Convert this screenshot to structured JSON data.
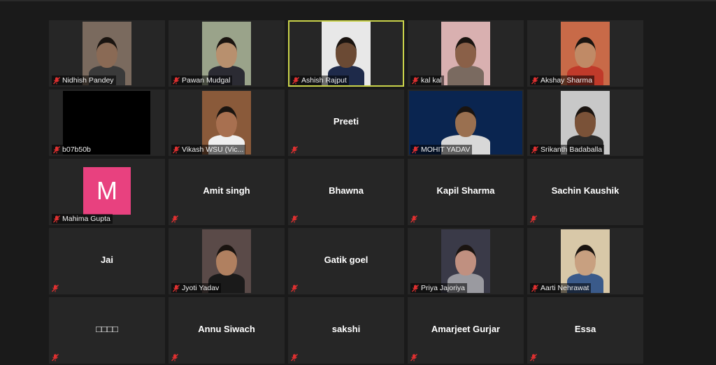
{
  "participants": [
    {
      "name": "Nidhish Pandey",
      "video": true,
      "bg": "#7a6a5e",
      "skin": "#8a6a55",
      "shirt": "#3a3a3a",
      "center": ""
    },
    {
      "name": "Pawan Mudgal",
      "video": true,
      "bg": "#9aa38a",
      "skin": "#b8906e",
      "shirt": "#2b2b33",
      "center": ""
    },
    {
      "name": "Ashish Rajput",
      "video": true,
      "active": true,
      "bg": "#e8e8e8",
      "skin": "#6b4a34",
      "shirt": "#1e2a4a",
      "center": ""
    },
    {
      "name": "kal kal",
      "video": true,
      "bg": "#d9b0b0",
      "skin": "#8a6048",
      "shirt": "#7a6a60",
      "center": ""
    },
    {
      "name": "Akshay Sharma",
      "video": true,
      "bg": "#c86a48",
      "skin": "#c08a66",
      "shirt": "#c03a2a",
      "center": ""
    },
    {
      "name": "b07b50b",
      "video": true,
      "bg": "#000000",
      "skin": "",
      "shirt": "",
      "center": ""
    },
    {
      "name": "Vikash WSU (Vic...",
      "video": true,
      "bg": "#8a5a3a",
      "skin": "#a87050",
      "shirt": "#f0f0f0",
      "center": ""
    },
    {
      "name": "",
      "video": false,
      "center": "Preeti"
    },
    {
      "name": "MOHIT YADAV",
      "video": true,
      "wide": true,
      "bg": "#0a2550",
      "skin": "#9a7050",
      "shirt": "#d8d8d8",
      "center": ""
    },
    {
      "name": "Srikanth Badaballa",
      "video": true,
      "bg": "#c8c8c8",
      "skin": "#7a5238",
      "shirt": "#2a2a2a",
      "center": ""
    },
    {
      "name": "Mahima Gupta",
      "video": false,
      "avatar": "M",
      "center": ""
    },
    {
      "name": "",
      "video": false,
      "center": "Amit singh"
    },
    {
      "name": "",
      "video": false,
      "center": "Bhawna"
    },
    {
      "name": "",
      "video": false,
      "center": "Kapil Sharma"
    },
    {
      "name": "",
      "video": false,
      "center": "Sachin Kaushik"
    },
    {
      "name": "",
      "video": false,
      "center": "Jai"
    },
    {
      "name": "Jyoti Yadav",
      "video": true,
      "bg": "#5a4a48",
      "skin": "#b08060",
      "shirt": "#1a1a1a",
      "center": ""
    },
    {
      "name": "",
      "video": false,
      "center": "Gatik goel"
    },
    {
      "name": "Priya Jajoriya",
      "video": true,
      "bg": "#3a3a48",
      "skin": "#c09080",
      "shirt": "#9a9aa0",
      "center": ""
    },
    {
      "name": "Aarti Nehrawat",
      "video": true,
      "bg": "#d8c8a8",
      "skin": "#c8a080",
      "shirt": "#3a5a8a",
      "center": ""
    },
    {
      "name": "",
      "video": false,
      "center": "□□□□"
    },
    {
      "name": "",
      "video": false,
      "center": "Annu Siwach"
    },
    {
      "name": "",
      "video": false,
      "center": "sakshi"
    },
    {
      "name": "",
      "video": false,
      "center": "Amarjeet Gurjar"
    },
    {
      "name": "",
      "video": false,
      "center": "Essa"
    }
  ],
  "colors": {
    "muted_mic": "#e03030",
    "active_border": "#c9d24a"
  },
  "icons": {
    "mic": "muted-mic-icon"
  }
}
